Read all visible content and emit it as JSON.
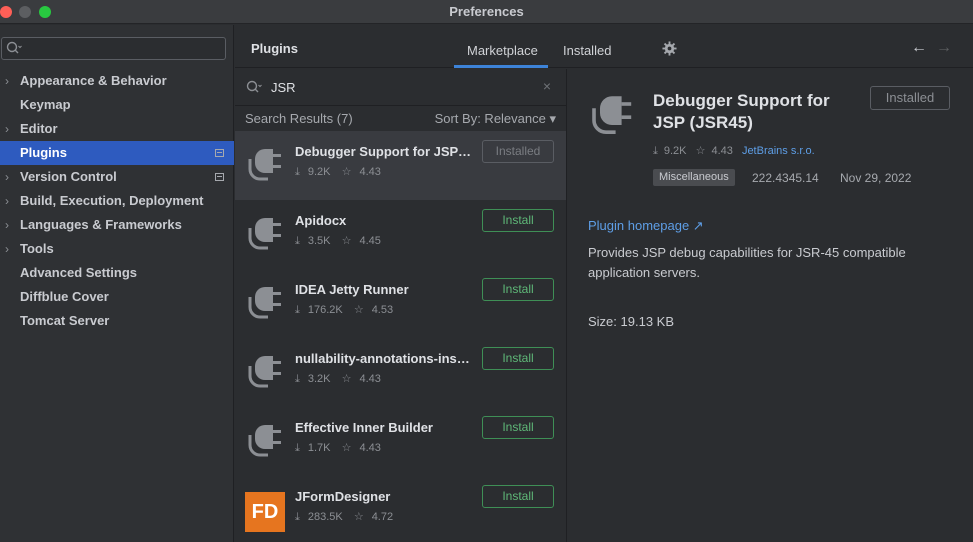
{
  "window": {
    "title": "Preferences"
  },
  "sidebar": {
    "search_placeholder": "",
    "search_icon": "search-icon",
    "items": [
      {
        "label": "Appearance & Behavior",
        "expandable": true
      },
      {
        "label": "Keymap",
        "expandable": false
      },
      {
        "label": "Editor",
        "expandable": true
      },
      {
        "label": "Plugins",
        "expandable": false,
        "active": true
      },
      {
        "label": "Version Control",
        "expandable": true
      },
      {
        "label": "Build, Execution, Deployment",
        "expandable": true
      },
      {
        "label": "Languages & Frameworks",
        "expandable": true
      },
      {
        "label": "Tools",
        "expandable": true
      },
      {
        "label": "Advanced Settings",
        "expandable": false
      },
      {
        "label": "Diffblue Cover",
        "expandable": false
      },
      {
        "label": "Tomcat Server",
        "expandable": false
      }
    ]
  },
  "header": {
    "title": "Plugins",
    "tabs": [
      {
        "label": "Marketplace",
        "active": true
      },
      {
        "label": "Installed",
        "active": false
      }
    ],
    "gear_icon": "gear-icon",
    "back_glyph": "←",
    "forward_glyph": "→"
  },
  "search": {
    "value": "JSR",
    "clear_glyph": "×"
  },
  "results": {
    "count_label": "Search Results (7)",
    "sort_label": "Sort By: Relevance ▾"
  },
  "plugins": [
    {
      "name": "Debugger Support for JSP (JSR45)",
      "downloads": "9.2K",
      "rating": "4.43",
      "button": "Installed",
      "installed": true,
      "icon": "plugin-plug-icon"
    },
    {
      "name": "Apidocx",
      "downloads": "3.5K",
      "rating": "4.45",
      "button": "Install",
      "installed": false,
      "icon": "plugin-plug-icon"
    },
    {
      "name": "IDEA Jetty Runner",
      "downloads": "176.2K",
      "rating": "4.53",
      "button": "Install",
      "installed": false,
      "icon": "plugin-plug-icon"
    },
    {
      "name": "nullability-annotations-inspection",
      "downloads": "3.2K",
      "rating": "4.43",
      "button": "Install",
      "installed": false,
      "icon": "plugin-plug-icon"
    },
    {
      "name": "Effective Inner Builder",
      "downloads": "1.7K",
      "rating": "4.43",
      "button": "Install",
      "installed": false,
      "icon": "plugin-plug-icon"
    },
    {
      "name": "JFormDesigner",
      "downloads": "283.5K",
      "rating": "4.72",
      "button": "Install",
      "installed": false,
      "icon": "jformdesigner-logo-icon",
      "logo_text": "FD"
    }
  ],
  "detail": {
    "name": "Debugger Support for JSP (JSR45)",
    "button": "Installed",
    "downloads": "9.2K",
    "rating": "4.43",
    "vendor": "JetBrains s.r.o.",
    "category": "Miscellaneous",
    "version": "222.4345.14",
    "date": "Nov 29, 2022",
    "homepage": "Plugin homepage ↗",
    "description": "Provides JSP debug capabilities for JSR-45 compatible application servers.",
    "size": "Size: 19.13 KB"
  },
  "colors": {
    "accent": "#2e5bbf",
    "tab_underline": "#3d83d8",
    "install_green": "#5fb878",
    "link_blue": "#5e9ee6"
  }
}
